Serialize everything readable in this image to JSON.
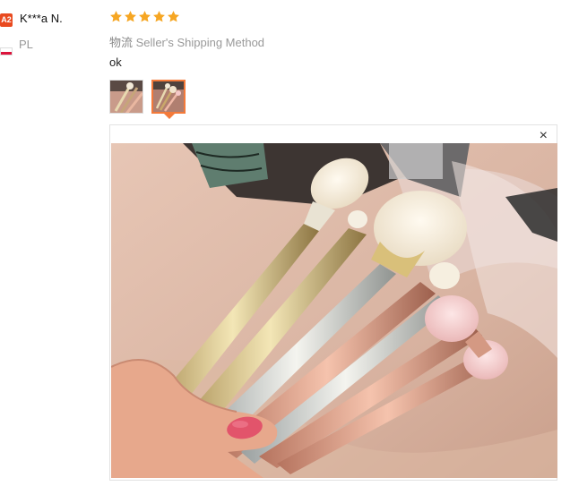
{
  "user": {
    "badge": "A2",
    "name": "K***a N.",
    "country": "PL",
    "flag_colors": {
      "top": "#ffffff",
      "bottom": "#dc143c"
    }
  },
  "review": {
    "rating": 5,
    "star_color": "#f6a623",
    "shipping_label": "物流",
    "shipping_method": "Seller's Shipping Method",
    "comment": "ok",
    "accent": "#f47a3a"
  },
  "viewer": {
    "close_symbol": "×"
  }
}
